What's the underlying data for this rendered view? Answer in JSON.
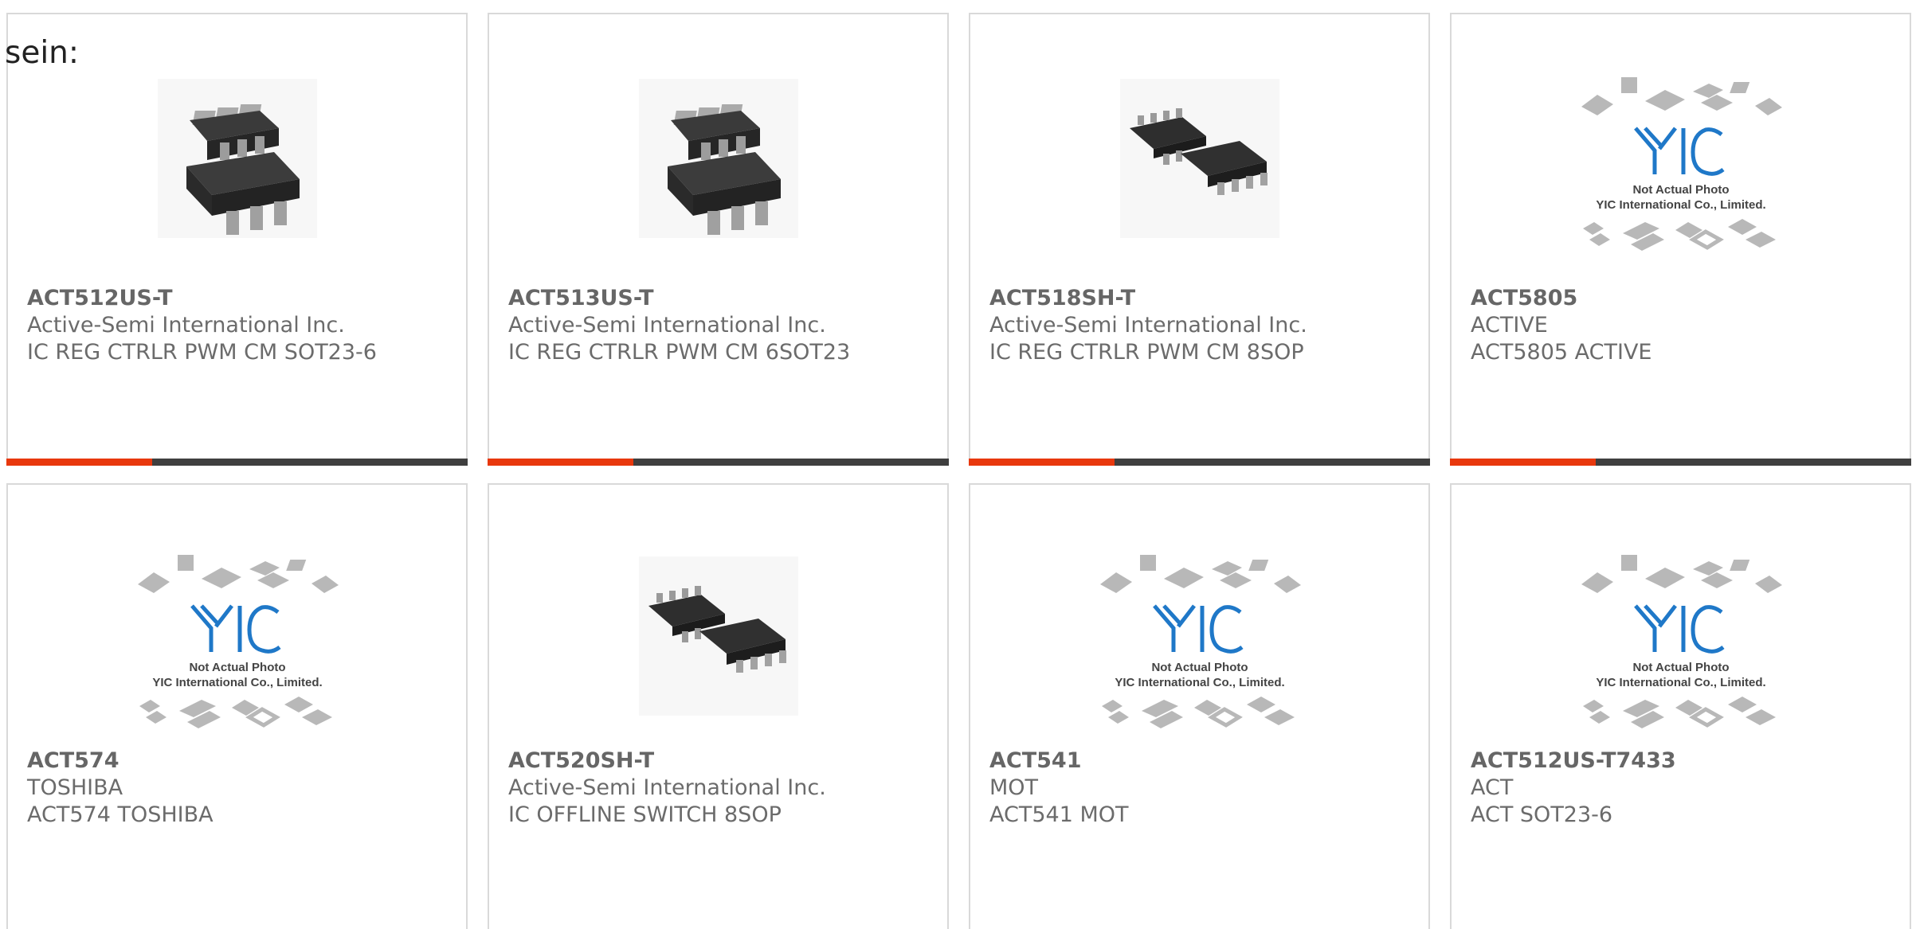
{
  "page": {
    "lead_text": "sein:"
  },
  "placeholder": {
    "line1": "Not Actual Photo",
    "line2": "YIC International Co., Limited."
  },
  "colors": {
    "accent": "#e8380d",
    "track": "#3f3f3f",
    "border": "#d9d9d9",
    "logo_blue": "#1f78c8"
  },
  "cards": [
    {
      "part": "ACT512US-T",
      "maker": "Active-Semi International Inc.",
      "desc": "IC REG CTRLR PWM CM SOT23-6",
      "image": "sot23-6-chip-photo"
    },
    {
      "part": "ACT513US-T",
      "maker": "Active-Semi International Inc.",
      "desc": "IC REG CTRLR PWM CM 6SOT23",
      "image": "sot23-6-chip-photo"
    },
    {
      "part": "ACT518SH-T",
      "maker": "Active-Semi International Inc.",
      "desc": "IC REG CTRLR PWM CM 8SOP",
      "image": "sop8-chip-photo"
    },
    {
      "part": "ACT5805",
      "maker": "ACTIVE",
      "desc": "ACT5805 ACTIVE",
      "image": "yic-placeholder-logo"
    },
    {
      "part": "ACT574",
      "maker": "TOSHIBA",
      "desc": "ACT574 TOSHIBA",
      "image": "yic-placeholder-logo"
    },
    {
      "part": "ACT520SH-T",
      "maker": "Active-Semi International Inc.",
      "desc": "IC OFFLINE SWITCH 8SOP",
      "image": "sop8-chip-photo"
    },
    {
      "part": "ACT541",
      "maker": "MOT",
      "desc": "ACT541 MOT",
      "image": "yic-placeholder-logo"
    },
    {
      "part": "ACT512US-T7433",
      "maker": "ACT",
      "desc": "ACT SOT23-6",
      "image": "yic-placeholder-logo"
    }
  ]
}
